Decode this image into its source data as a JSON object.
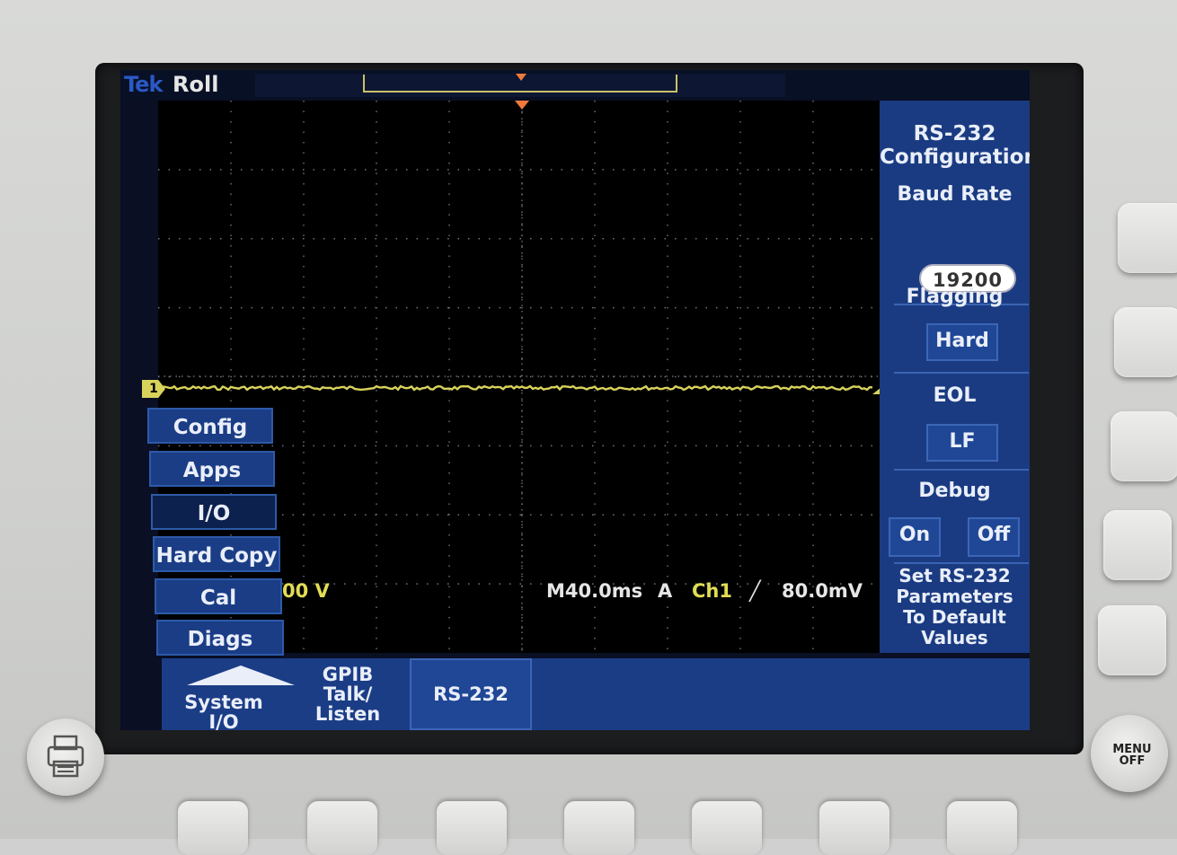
{
  "header": {
    "brand": "Tek",
    "acquisition_mode": "Roll"
  },
  "readouts": {
    "ch1_scale": "00 V",
    "timebase": "M40.0ms",
    "trigger_mode": "A",
    "trigger_source": "Ch1",
    "trigger_level": "80.0mV"
  },
  "channel_marker": "1",
  "left_menu": [
    {
      "label": "Config"
    },
    {
      "label": "Apps"
    },
    {
      "label": "I/O"
    },
    {
      "label": "Hard Copy"
    },
    {
      "label": "Cal"
    },
    {
      "label": "Diags"
    }
  ],
  "bottom_menu": {
    "system_line1": "System",
    "system_line2": "I/O",
    "gpib_line1": "GPIB",
    "gpib_line2": "Talk/",
    "gpib_line3": "Listen",
    "rs232": "RS-232"
  },
  "side_menu": {
    "title_line1": "RS-232",
    "title_line2": "Configuration",
    "baud_label": "Baud Rate",
    "baud_value": "19200",
    "flagging_label": "Flagging",
    "flagging_value": "Hard",
    "eol_label": "EOL",
    "eol_value": "LF",
    "debug_label": "Debug",
    "debug_on": "On",
    "debug_off": "Off",
    "default_line1": "Set RS-232",
    "default_line2": "Parameters",
    "default_line3": "To Default",
    "default_line4": "Values"
  },
  "front_panel": {
    "menu_off_line1": "MENU",
    "menu_off_line2": "OFF"
  },
  "colors": {
    "trace": "#d8d35a",
    "menu_blue": "#1b3d86",
    "trigger_marker": "#f07a3a"
  }
}
